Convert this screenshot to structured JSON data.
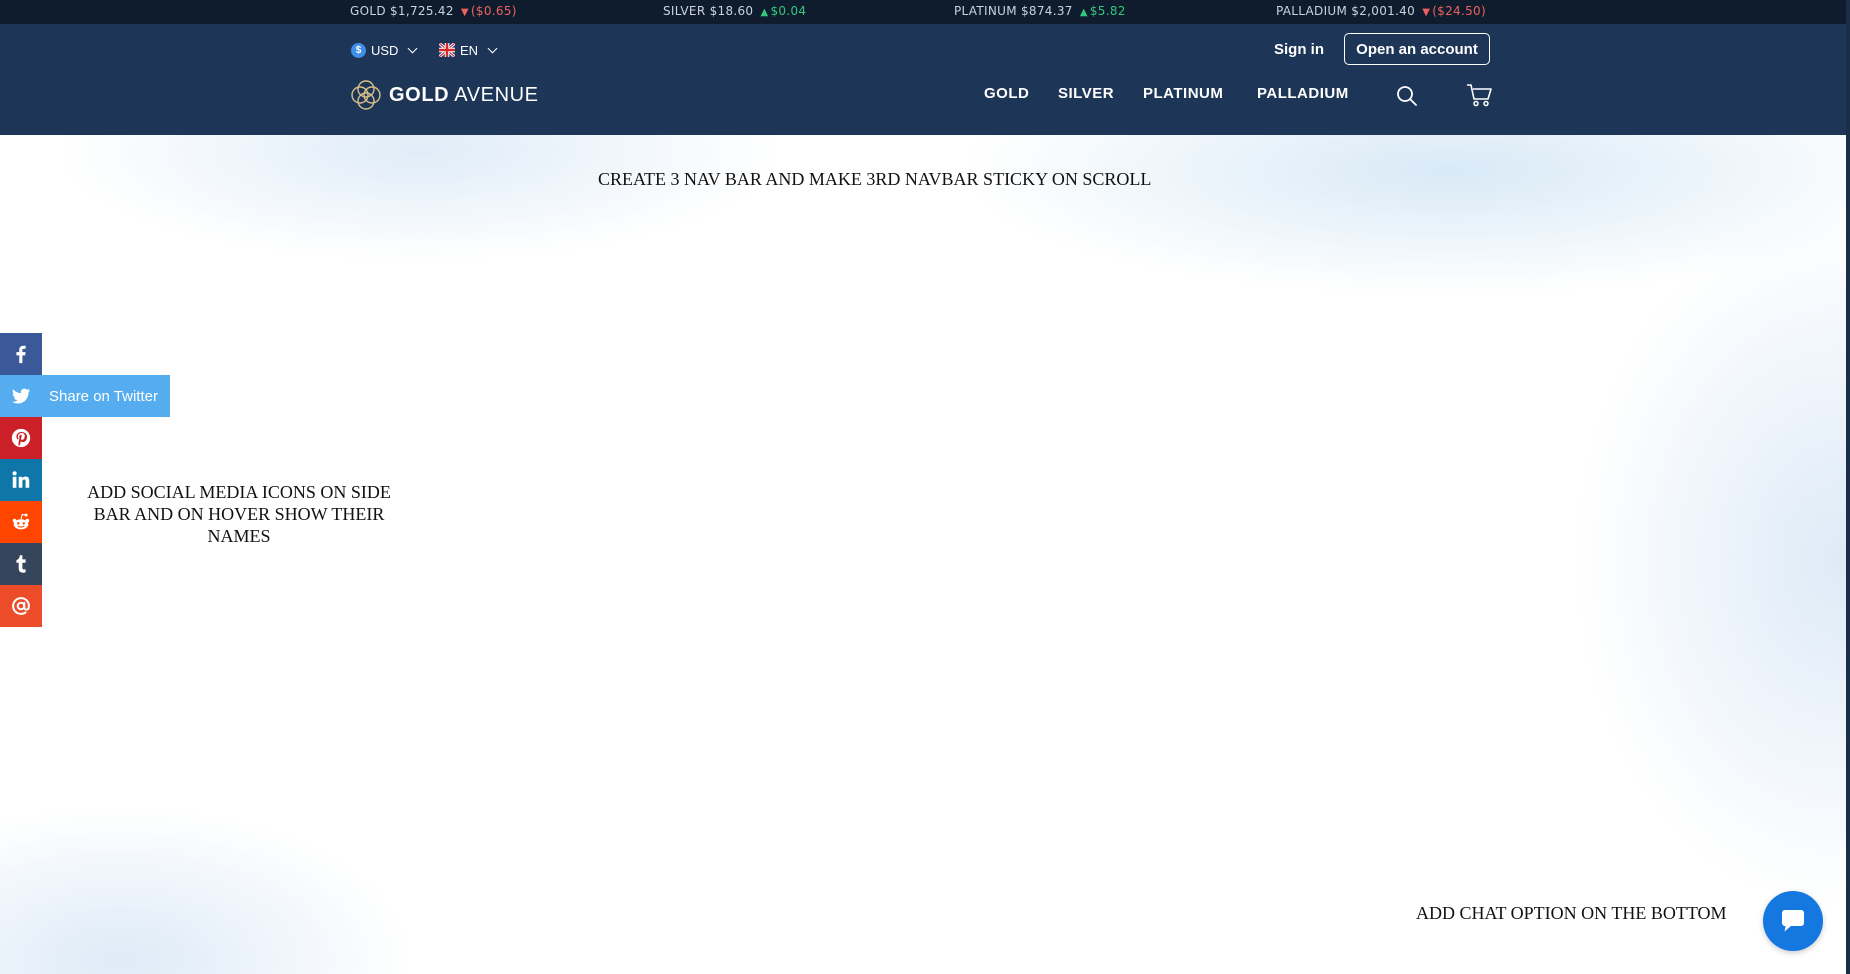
{
  "ticker": [
    {
      "metal": "GOLD",
      "price": "$1,725.42",
      "direction": "down",
      "change": "($0.65)"
    },
    {
      "metal": "SILVER",
      "price": "$18.60",
      "direction": "up",
      "change": "$0.04"
    },
    {
      "metal": "PLATINUM",
      "price": "$874.37",
      "direction": "up",
      "change": "$5.82"
    },
    {
      "metal": "PALLADIUM",
      "price": "$2,001.40",
      "direction": "down",
      "change": "($24.50)"
    }
  ],
  "header": {
    "currency": {
      "value": "USD",
      "icon": "dollar-icon"
    },
    "language": {
      "value": "EN",
      "icon": "uk-flag-icon"
    },
    "signin_label": "Sign in",
    "open_account_label": "Open an account",
    "logo": {
      "bold": "GOLD",
      "light": "AVENUE"
    },
    "nav": [
      "GOLD",
      "SILVER",
      "PLATINUM",
      "PALLADIUM"
    ],
    "icons": [
      "search-icon",
      "cart-icon"
    ]
  },
  "notes": {
    "top": "CREATE 3 NAV BAR AND MAKE 3RD NAVBAR STICKY ON SCROLL",
    "side": "ADD SOCIAL MEDIA ICONS ON SIDE BAR AND ON HOVER SHOW THEIR NAMES",
    "bottom": "ADD CHAT OPTION ON THE BOTTOM"
  },
  "social": [
    {
      "name": "facebook",
      "color": "#3b5998"
    },
    {
      "name": "twitter",
      "color": "#55acee",
      "hover_label": "Share on Twitter"
    },
    {
      "name": "pinterest",
      "color": "#cb2027"
    },
    {
      "name": "linkedin",
      "color": "#0e76a8"
    },
    {
      "name": "reddit",
      "color": "#ff4500"
    },
    {
      "name": "tumblr",
      "color": "#35465c"
    },
    {
      "name": "email",
      "color": "#ec4c2a"
    }
  ],
  "colors": {
    "ticker_bg": "#0f1c2e",
    "header_bg": "#1d3556",
    "chat_button": "#1478e0",
    "down": "#ef6060",
    "up": "#34c77b"
  }
}
